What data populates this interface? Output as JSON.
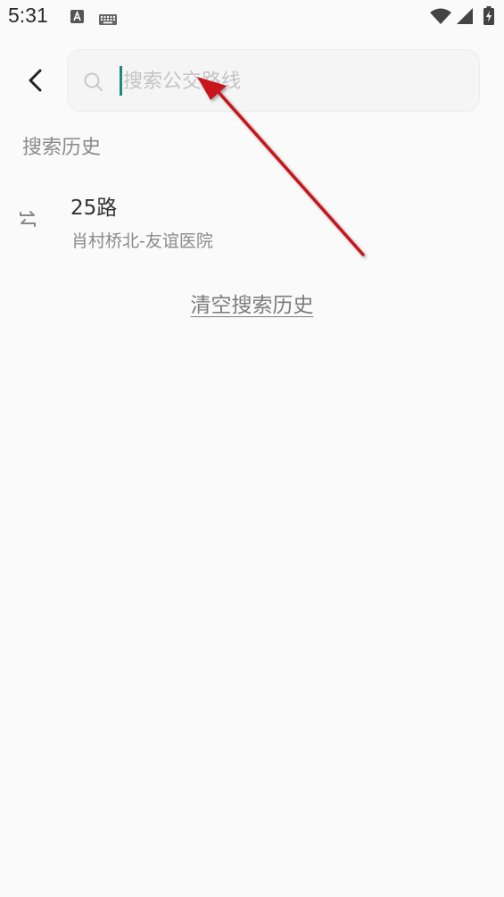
{
  "status_bar": {
    "time": "5:31",
    "icons": [
      "text-a-icon",
      "keyboard-icon",
      "wifi-icon",
      "signal-icon",
      "battery-charging-icon"
    ]
  },
  "header": {
    "back_icon": "chevron-left-icon",
    "search": {
      "icon": "search-icon",
      "placeholder": "搜索公交路线",
      "value": ""
    }
  },
  "history": {
    "title": "搜索历史",
    "items": [
      {
        "icon": "swap-icon",
        "route": "25路",
        "stops": "肖村桥北-友谊医院"
      }
    ],
    "clear_label": "清空搜索历史"
  },
  "colors": {
    "background": "#fafafa",
    "cursor": "#1a8a7a",
    "annotation_arrow": "#c8161d"
  }
}
